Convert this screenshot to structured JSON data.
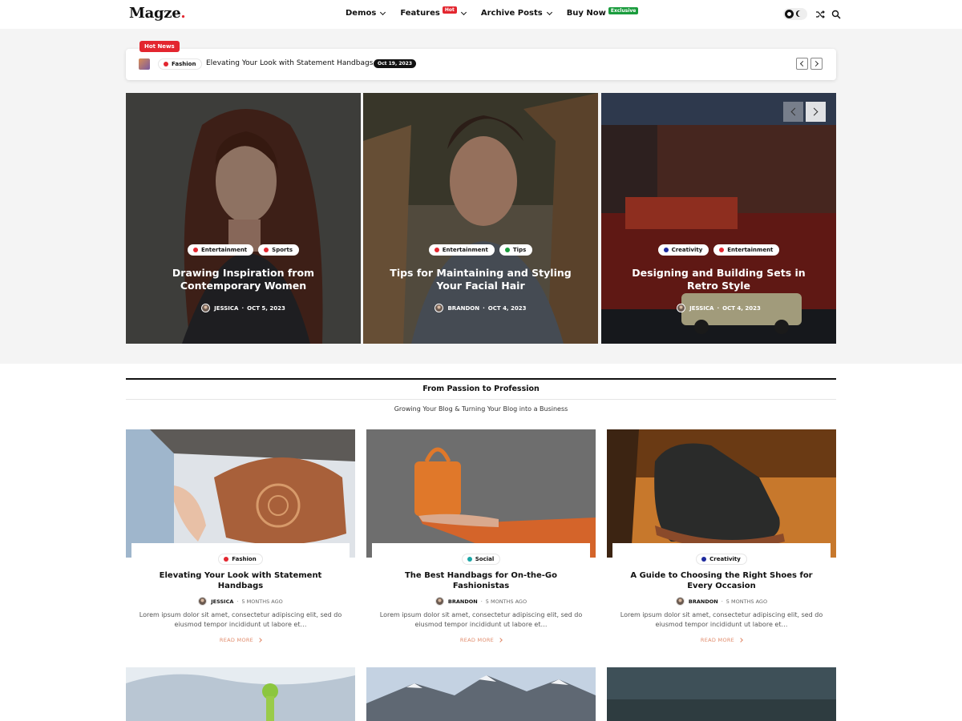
{
  "header": {
    "logo": "Magze",
    "logo_dot": ".",
    "nav": [
      {
        "label": "Demos"
      },
      {
        "label": "Features",
        "badge": "Hot"
      },
      {
        "label": "Archive Posts"
      },
      {
        "label": "Buy Now",
        "badge": "Exclusive"
      }
    ],
    "icons": [
      "theme-toggle-icon",
      "shuffle-icon",
      "search-icon"
    ]
  },
  "ticker": {
    "tag": "Hot News",
    "category": "Fashion",
    "category_color": "#e3262f",
    "title": "Elevating Your Look with Statement Handbags",
    "date": "Oct 19, 2023"
  },
  "slides": [
    {
      "cats": [
        {
          "label": "Entertainment",
          "color": "#e3262f"
        },
        {
          "label": "Sports",
          "color": "#e3262f"
        }
      ],
      "title": "Drawing Inspiration from Contemporary Women",
      "author": "JESSICA",
      "date": "OCT 5, 2023"
    },
    {
      "cats": [
        {
          "label": "Entertainment",
          "color": "#e3262f"
        },
        {
          "label": "Tips",
          "color": "#1a9c3d"
        }
      ],
      "title": "Tips for Maintaining and Styling Your Facial Hair",
      "author": "BRANDON",
      "date": "OCT 4, 2023"
    },
    {
      "cats": [
        {
          "label": "Creativity",
          "color": "#1e2a9e"
        },
        {
          "label": "Entertainment",
          "color": "#e3262f"
        }
      ],
      "title": "Designing and Building Sets in Retro Style",
      "author": "JESSICA",
      "date": "OCT 4, 2023"
    }
  ],
  "section": {
    "title": "From Passion to Profession",
    "subtitle": "Growing Your Blog & Turning Your Blog into a Business"
  },
  "posts": [
    {
      "category": "Fashion",
      "category_color": "#e3262f",
      "title": "Elevating Your Look with Statement Handbags",
      "author": "JESSICA",
      "time": "5 MONTHS AGO",
      "excerpt": "Lorem ipsum dolor sit amet, consectetur adipiscing elit, sed do eiusmod tempor incididunt ut labore et…",
      "read_more": "READ MORE"
    },
    {
      "category": "Social",
      "category_color": "#1aa6a6",
      "title": "The Best Handbags for On-the-Go Fashionistas",
      "author": "BRANDON",
      "time": "5 MONTHS AGO",
      "excerpt": "Lorem ipsum dolor sit amet, consectetur adipiscing elit, sed do eiusmod tempor incididunt ut labore et…",
      "read_more": "READ MORE"
    },
    {
      "category": "Creativity",
      "category_color": "#1e2a9e",
      "title": "A Guide to Choosing the Right Shoes for Every Occasion",
      "author": "BRANDON",
      "time": "5 MONTHS AGO",
      "excerpt": "Lorem ipsum dolor sit amet, consectetur adipiscing elit, sed do eiusmod tempor incididunt ut labore et…",
      "read_more": "READ MORE"
    }
  ]
}
